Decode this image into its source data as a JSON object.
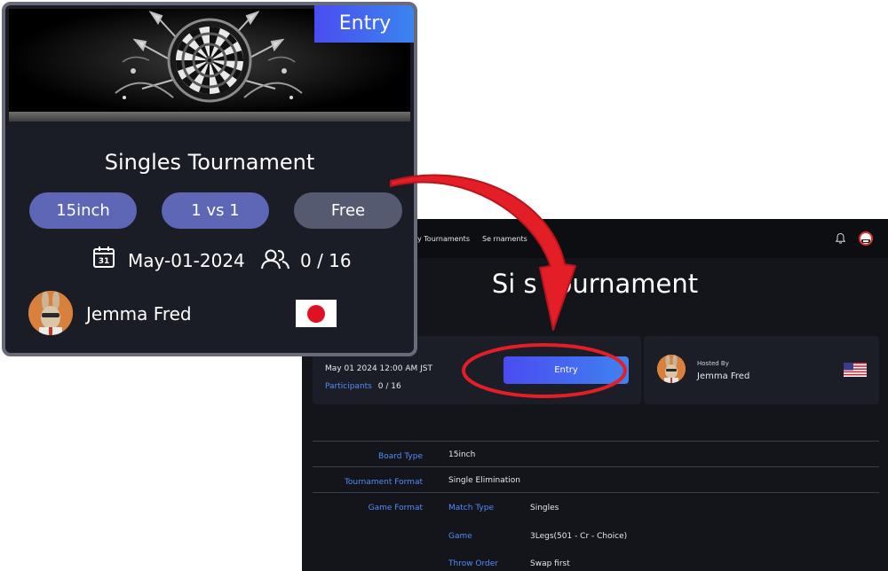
{
  "detail_page": {
    "nav": {
      "my_tournaments": "y Tournaments",
      "search_tournaments": "Se          rnaments"
    },
    "title": "Si          s Tournament",
    "schedule": {
      "datetime": "May 01 2024 12:00 AM JST"
    },
    "participants": {
      "label": "Participants",
      "value": "0 / 16"
    },
    "entry_button": "Entry",
    "host": {
      "hosted_by_label": "Hosted By",
      "name": "Jemma Fred",
      "country_flag": "us-flag"
    },
    "details": {
      "board_type": {
        "label": "Board Type",
        "value": "15inch"
      },
      "tournament_format": {
        "label": "Tournament Format",
        "value": "Single Elimination"
      },
      "game_format": {
        "label": "Game Format",
        "items": [
          {
            "label": "Match Type",
            "value": "Singles"
          },
          {
            "label": "Game",
            "value": "3Legs(501 - Cr - Choice)"
          },
          {
            "label": "Throw Order",
            "value": "Swap first"
          }
        ]
      }
    },
    "colors": {
      "background": "#13151b",
      "card": "#1b1e26",
      "link": "#4f8cff",
      "button": "#4a4cf0"
    }
  },
  "tournament_card": {
    "badge": "Entry",
    "title": "Singles Tournament",
    "tags": {
      "board": "15inch",
      "mode": "1 vs 1",
      "fee": "Free"
    },
    "date": "May-01-2024",
    "participants": "0 / 16",
    "host_name": "Jemma Fred",
    "host_flag": "jp-flag",
    "colors": {
      "background": "#1a1d26",
      "border": "#676b7a",
      "tag": "#5e66b6",
      "fee_tag": "#565a70"
    }
  },
  "annotation": {
    "arrow_color": "#e41e26",
    "highlight_color": "#e41e26"
  }
}
